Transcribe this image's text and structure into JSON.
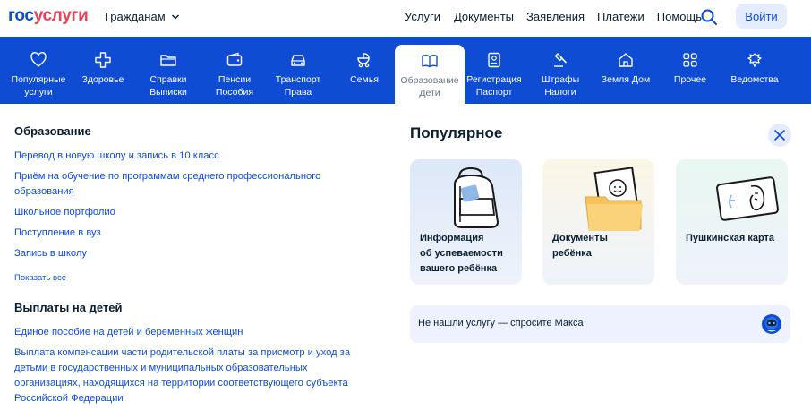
{
  "header": {
    "logo_part1": "гос",
    "logo_part2": "услуги",
    "audience": "Гражданам",
    "nav": [
      "Услуги",
      "Документы",
      "Заявления",
      "Платежи",
      "Помощь"
    ],
    "login": "Войти",
    "colors": {
      "brand_blue": "#0d4cd3",
      "brand_red": "#ee3f58"
    }
  },
  "categories": [
    {
      "line1": "Популярные",
      "line2": "услуги",
      "icon": "heart-icon"
    },
    {
      "line1": "Здоровье",
      "line2": "",
      "icon": "medical-cross-icon"
    },
    {
      "line1": "Справки",
      "line2": "Выписки",
      "icon": "folder-icon"
    },
    {
      "line1": "Пенсии",
      "line2": "Пособия",
      "icon": "wallet-icon"
    },
    {
      "line1": "Транспорт",
      "line2": "Права",
      "icon": "car-icon"
    },
    {
      "line1": "Семья",
      "line2": "",
      "icon": "stroller-icon"
    },
    {
      "line1": "Образование",
      "line2": "Дети",
      "icon": "book-icon",
      "active": true
    },
    {
      "line1": "Регистрация",
      "line2": "Паспорт",
      "icon": "passport-icon"
    },
    {
      "line1": "Штрафы",
      "line2": "Налоги",
      "icon": "gavel-icon"
    },
    {
      "line1": "Земля Дом",
      "line2": "",
      "icon": "house-icon"
    },
    {
      "line1": "Прочее",
      "line2": "",
      "icon": "grid-icon"
    },
    {
      "line1": "Ведомства",
      "line2": "",
      "icon": "emblem-icon"
    }
  ],
  "education": {
    "title": "Образование",
    "links": [
      "Перевод в новую школу и запись в 10 класс",
      "Приём на обучение по программам среднего профессионального",
      "образования",
      "Школьное портфолио",
      "Поступление в вуз",
      "Запись в школу"
    ],
    "show_all": "Показать все"
  },
  "payments": {
    "title": "Выплаты на детей",
    "links": [
      "Единое пособие на детей и беременных женщин",
      "Выплата компенсации части родительской платы за присмотр и уход за",
      "детьми в государственных и муниципальных образовательных",
      "организациях, находящихся на территории соответствующего субъекта",
      "Российской Федерации"
    ]
  },
  "popular": {
    "title": "Популярное",
    "cards": [
      {
        "line1": "Информация",
        "line2": "об успеваемости",
        "line3": "вашего ребёнка",
        "icon": "backpack-icon"
      },
      {
        "line1": "Документы",
        "line2": "ребёнка",
        "line3": "",
        "icon": "child-documents-icon"
      },
      {
        "line1": "Пушкинская карта",
        "line2": "",
        "line3": "",
        "icon": "pushkin-card-icon"
      }
    ],
    "ask": "Не нашли услугу — спросите Макса"
  }
}
